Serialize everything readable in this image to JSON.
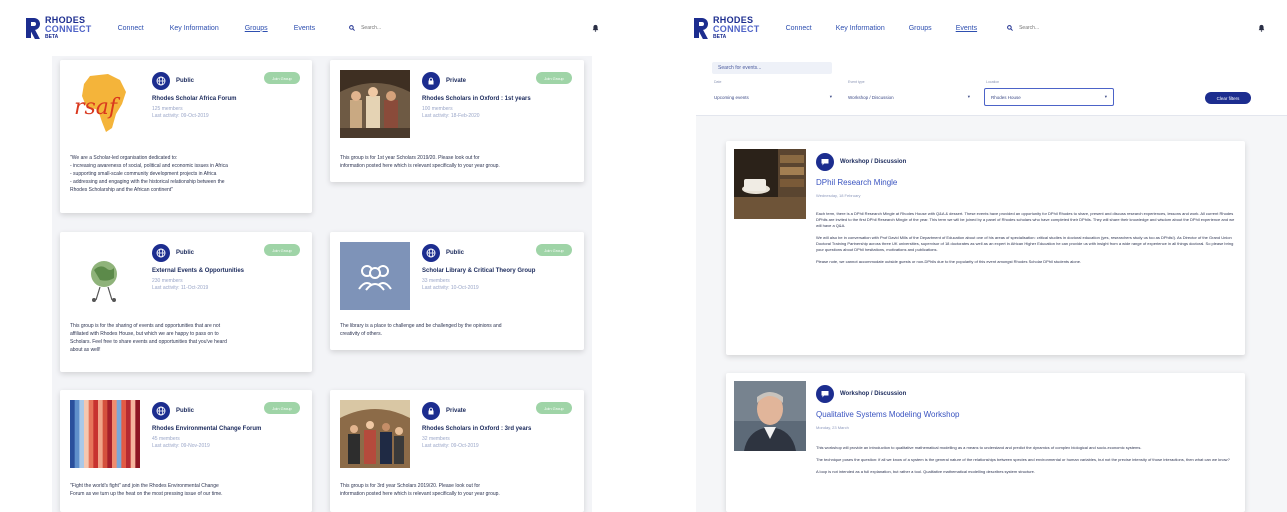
{
  "brand": {
    "line1": "RHODES",
    "line2": "CONNECT",
    "line3": "BETA"
  },
  "colors": {
    "navy": "#1c2d8f",
    "link": "#2e4fb0",
    "join_green": "#9fd4a7"
  },
  "left": {
    "nav": {
      "links": [
        "Connect",
        "Key Information",
        "Groups",
        "Events"
      ],
      "active": "Groups",
      "search_placeholder": "Search..."
    },
    "cards": [
      {
        "privacy": "Public",
        "privacy_icon": "globe-icon",
        "join": "Join Group",
        "title": "Rhodes Scholar Africa Forum",
        "meta1": "125 members",
        "meta2": "Last activity: 09-Oct-2019",
        "desc": [
          "\"We are a Scholar-led organisation dedicated to:",
          "- increasing awareness of social, political and economic issues in Africa",
          "- supporting small-scale community development projects in Africa",
          "- addressing and engaging with the historical relationship between the",
          "Rhodes Scholarship and the African continent\""
        ]
      },
      {
        "privacy": "Private",
        "privacy_icon": "lock-icon",
        "join": "Join Group",
        "title": "Rhodes Scholars in Oxford : 1st years",
        "meta1": "100 members",
        "meta2": "Last activity: 18-Feb-2020",
        "desc": [
          "This group is for 1st year Scholars 2019/20. Please look out for",
          "information posted here which is relevant specifically to your year group."
        ]
      },
      {
        "privacy": "Public",
        "privacy_icon": "globe-icon",
        "join": "Join Group",
        "title": "External Events & Opportunities",
        "meta1": "230 members",
        "meta2": "Last activity: 11-Oct-2019",
        "desc": [
          "This group is for the sharing of events and opportunities that are not",
          "affiliated with Rhodes House, but which we are happy to pass on to",
          "Scholars. Feel free to share events and opportunities that you've heard",
          "about as well!"
        ]
      },
      {
        "privacy": "Public",
        "privacy_icon": "globe-icon",
        "join": "Join Group",
        "title": "Scholar Library & Critical Theory Group",
        "meta1": "33 members",
        "meta2": "Last activity: 10-Oct-2019",
        "desc": [
          "The library is a place to challenge and be challenged by the opinions and",
          "creativity of others."
        ]
      },
      {
        "privacy": "Public",
        "privacy_icon": "globe-icon",
        "join": "Join Group",
        "title": "Rhodes Environmental Change Forum",
        "meta1": "45 members",
        "meta2": "Last activity: 09-Nov-2019",
        "desc": [
          "\"Fight the world's fight\" and join the Rhodes Environmental Change",
          "Forum as we turn up the heat on the most pressing issue of our time."
        ]
      },
      {
        "privacy": "Private",
        "privacy_icon": "lock-icon",
        "join": "Join Group",
        "title": "Rhodes Scholars in Oxford : 3rd years",
        "meta1": "32 members",
        "meta2": "Last activity: 09-Oct-2019",
        "desc": [
          "This group is for 3rd year Scholars 2019/20. Please look out for",
          "information posted here which is relevant specifically to your year group."
        ]
      }
    ]
  },
  "right": {
    "nav": {
      "links": [
        "Connect",
        "Key Information",
        "Groups",
        "Events"
      ],
      "active": "Events",
      "search_placeholder": "Search..."
    },
    "filters": {
      "search": "Search for events...",
      "when_label": "Date",
      "when_value": "Upcoming events",
      "type_label": "Event type",
      "type_value": "Workshop / Discussion",
      "loc_label": "Location",
      "loc_value": "Rhodes House",
      "clear": "Clear filters"
    },
    "events": [
      {
        "type": "Workshop / Discussion",
        "title": "DPhil Research Mingle",
        "date": "Wednesday, 18 February",
        "paras": [
          "Each term, there is a DPhil Research Mingle at Rhodes House with Q&A & dessert. These events have provided an opportunity for DPhil Rhodes to share, present and discuss research experiences, lessons and work. All current Rhodes DPhils are invited to the first DPhil Research Mingle of the year. This term we will be joined by a panel of Rhodes scholars who have completed their DPhils. They will share their knowledge and wisdom about the DPhil experience and we will have a Q&A.",
          "We will also be in conversation with Prof David Mills of the Department of Education about one of his areas of specialisation: critical studies in doctoral education (yes, researchers study us too as DPhils!). As Director of the Grand Union Doctoral Training Partnership across three UK universities, supervisor of 18 doctorates as well as an expert in African Higher Education he can provide us with insight from a wide range of experience in all things doctoral. So please bring your questions about DPhil hesitations, motivations and publications.",
          "Please note, we cannot accommodate outside guests or non-DPhils due to the popularity of this event amongst Rhodes Scholar DPhil students alone."
        ]
      },
      {
        "type": "Workshop / Discussion",
        "title": "Qualitative Systems Modeling Workshop",
        "date": "Monday, 23 March",
        "paras": [
          "This workshop will provide an introduction to qualitative mathematical modelling as a means to understand and predict the dynamics of complex biological and socio-economic systems.",
          "The technique poses the question: if all we know of a system is the general nature of the relationships between species and environmental or human variables, but not the precise intensity of those interactions, then what can we know?",
          "A loop is not intended as a full explanation, but rather a tool. Qualitative mathematical modelling describes system structure."
        ]
      }
    ]
  }
}
